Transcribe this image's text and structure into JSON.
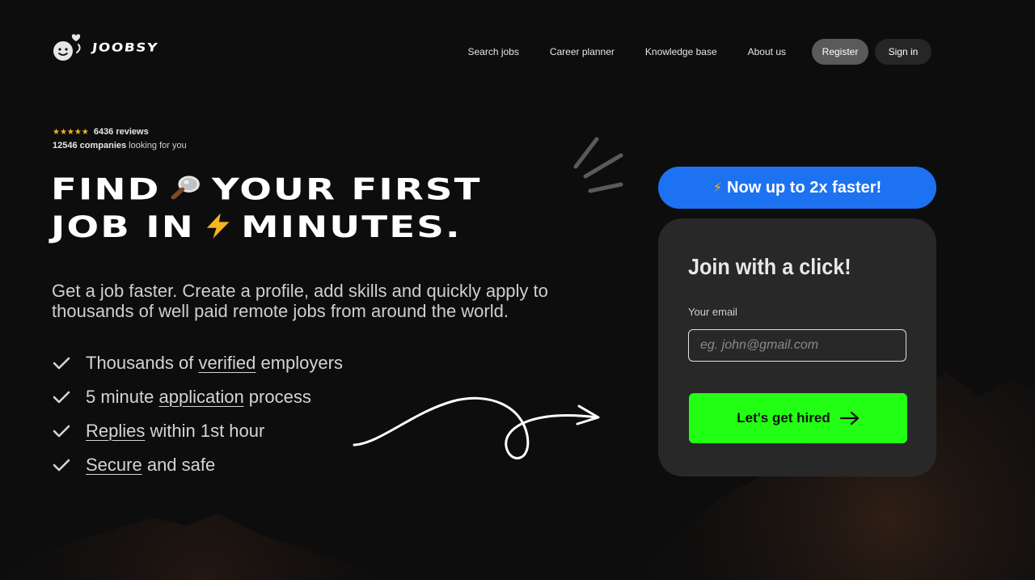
{
  "brand": {
    "name": "JOOBSY",
    "logo_icon": "smiley-heart-icon"
  },
  "nav": {
    "links": [
      "Search jobs",
      "Career planner",
      "Knowledge base",
      "About us"
    ],
    "register_label": "Register",
    "signin_label": "Sign in"
  },
  "reviews": {
    "stars": "★★★★★",
    "rating_stars": 5,
    "reviews_count": "6436 reviews",
    "companies_count": "12546 companies",
    "companies_suffix": " looking for you"
  },
  "hero": {
    "line1_a": "FIND",
    "line1_emoji": "🔎",
    "line1_b": "YOUR FIRST",
    "line2_a": "JOB IN",
    "line2_emoji": "⚡",
    "line2_b": "MINUTES.",
    "subtext": "Get a job faster. Create a profile, add skills and quickly apply to thousands of well paid remote jobs from around the world."
  },
  "features": [
    {
      "pre": "Thousands of ",
      "link": "verified",
      "post": " employers"
    },
    {
      "pre": "5 minute ",
      "link": "application",
      "post": " process"
    },
    {
      "pre": "",
      "link": "Replies",
      "post": " within 1st hour"
    },
    {
      "pre": "",
      "link": "Secure",
      "post": " and safe"
    }
  ],
  "signup": {
    "badge_icon": "⚡",
    "badge_text": "Now up to 2x faster!",
    "title": "Join with a click!",
    "email_label": "Your email",
    "email_placeholder": "eg. john@gmail.com",
    "email_value": "",
    "cta_label": "Let's get hired"
  },
  "colors": {
    "background": "#0d0d0d",
    "accent_blue": "#1d72f2",
    "accent_green": "#22ff14",
    "star_yellow": "#f5b71f",
    "card_bg": "#2a2a2a"
  }
}
